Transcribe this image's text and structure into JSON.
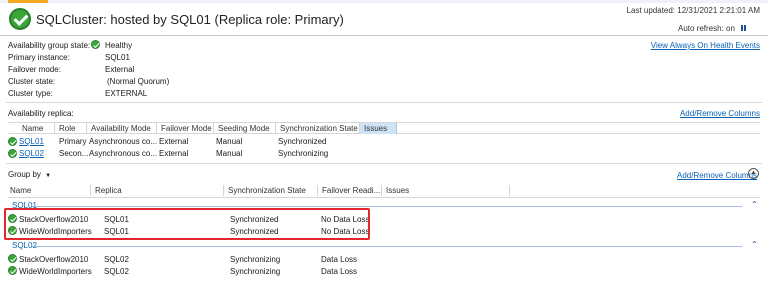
{
  "topbar": {
    "accent": "#f4a81d"
  },
  "header": {
    "title": "SQLCluster: hosted by SQL01 (Replica role: Primary)",
    "last_updated": "Last updated: 12/31/2021 2:21:01 AM",
    "auto_refresh": "Auto refresh: on",
    "view_events": "View Always On Health Events"
  },
  "summary": {
    "rows": [
      {
        "label": "Availability group state:",
        "value": "Healthy",
        "icon": "ok-icon"
      },
      {
        "label": "Primary instance:",
        "value": "SQL01"
      },
      {
        "label": "Failover mode:",
        "value": "External"
      },
      {
        "label": "Cluster state:",
        "value": "(Normal Quorum)"
      },
      {
        "label": "Cluster type:",
        "value": "EXTERNAL"
      }
    ]
  },
  "replicas": {
    "label": "Availability replica:",
    "add_remove": "Add/Remove Columns",
    "columns": [
      "Name",
      "Role",
      "Availability Mode",
      "Failover Mode",
      "Seeding Mode",
      "Synchronization State",
      "Issues"
    ],
    "rows": [
      {
        "name": "SQL01",
        "role": "Primary",
        "mode": "Asynchronous co...",
        "failover": "External",
        "seeding": "Manual",
        "sync": "Synchronized",
        "issues": ""
      },
      {
        "name": "SQL02",
        "role": "Secon...",
        "mode": "Asynchronous co...",
        "failover": "External",
        "seeding": "Manual",
        "sync": "Synchronizing",
        "issues": ""
      }
    ]
  },
  "databases": {
    "group_by": "Group by",
    "add_remove": "Add/Remove Columns",
    "columns": [
      "Name",
      "Replica",
      "Synchronization State",
      "Failover Readi...",
      "Issues"
    ],
    "groups": [
      {
        "name": "SQL01",
        "rows": [
          {
            "db": "StackOverflow2010",
            "replica": "SQL01",
            "sync": "Synchronized",
            "failover": "No Data Loss"
          },
          {
            "db": "WideWorldImporters",
            "replica": "SQL01",
            "sync": "Synchronized",
            "failover": "No Data Loss"
          }
        ]
      },
      {
        "name": "SQL02",
        "rows": [
          {
            "db": "StackOverflow2010",
            "replica": "SQL02",
            "sync": "Synchronizing",
            "failover": "Data Loss"
          },
          {
            "db": "WideWorldImporters",
            "replica": "SQL02",
            "sync": "Synchronizing",
            "failover": "Data Loss"
          }
        ]
      }
    ]
  },
  "highlight_color": "#e0282d"
}
